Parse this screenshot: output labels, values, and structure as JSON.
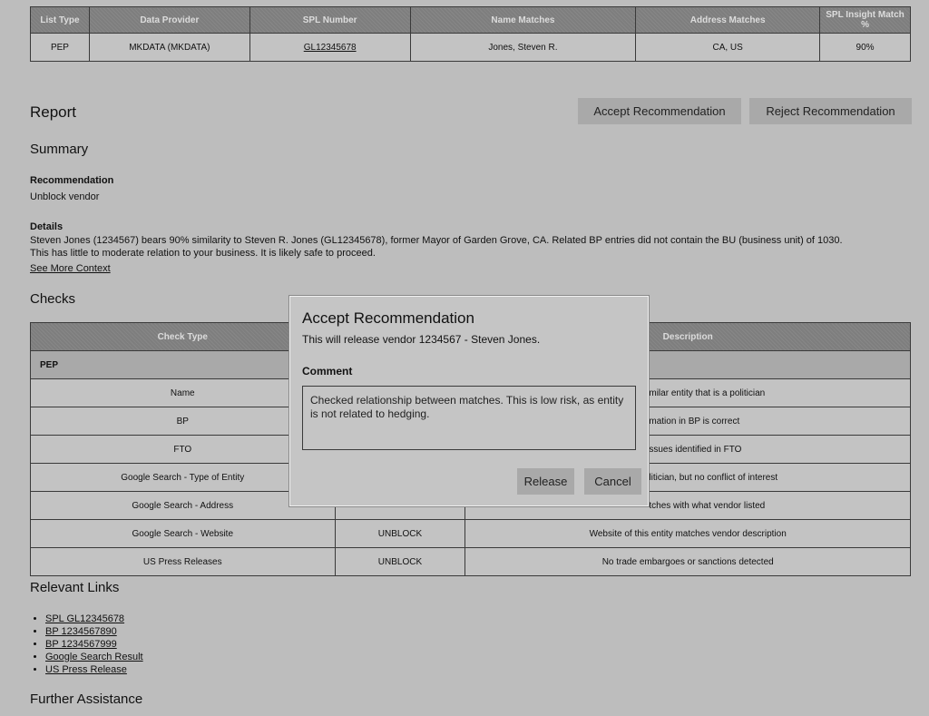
{
  "match_table": {
    "headers": [
      "List Type",
      "Data Provider",
      "SPL Number",
      "Name Matches",
      "Address Matches",
      "SPL Insight Match %"
    ],
    "row": {
      "list_type": "PEP",
      "data_provider": "MKDATA (MKDATA)",
      "spl_number": "GL12345678",
      "name_matches": "Jones, Steven R.",
      "address_matches": "CA, US",
      "insight_match": "90%"
    }
  },
  "report": {
    "title": "Report",
    "accept_label": "Accept Recommendation",
    "reject_label": "Reject Recommendation"
  },
  "summary": {
    "heading": "Summary",
    "recommendation_label": "Recommendation",
    "recommendation_value": "Unblock vendor",
    "details_label": "Details",
    "details_line1": "Steven Jones (1234567) bears 90% similarity to Steven R. Jones (GL12345678), former Mayor of Garden Grove, CA. Related BP entries did not contain the BU (business unit) of 1030.",
    "details_line2": "This has little to moderate relation to your business. It is likely safe to proceed.",
    "see_more": "See More Context"
  },
  "checks": {
    "heading": "Checks",
    "headers": [
      "Check Type",
      "",
      "Description"
    ],
    "group": "PEP",
    "rows": [
      {
        "type": "Name",
        "result": "",
        "description": "milar entity that is a politician"
      },
      {
        "type": "BP",
        "result": "",
        "description": "mation in BP is correct"
      },
      {
        "type": "FTO",
        "result": "",
        "description": "ssues identified in FTO"
      },
      {
        "type": "Google Search - Type of Entity",
        "result": "",
        "description": "litician, but no conflict of interest"
      },
      {
        "type": "Google Search - Address",
        "result": "",
        "description": "tches with what vendor listed"
      },
      {
        "type": "Google Search - Website",
        "result": "UNBLOCK",
        "description": "Website of this entity matches vendor description"
      },
      {
        "type": "US Press Releases",
        "result": "UNBLOCK",
        "description": "No trade embargoes or sanctions detected"
      }
    ]
  },
  "links": {
    "heading": "Relevant Links",
    "items": [
      "SPL GL12345678",
      "BP 1234567890",
      "BP 1234567999",
      "Google Search Result",
      "US Press Release"
    ]
  },
  "further": {
    "heading": "Further Assistance"
  },
  "modal": {
    "title": "Accept Recommendation",
    "subtitle": "This will release vendor 1234567 - Steven Jones.",
    "comment_label": "Comment",
    "comment_value": "Checked relationship between matches. This is low risk, as entity is not related to hedging.",
    "release_label": "Release",
    "cancel_label": "Cancel"
  }
}
